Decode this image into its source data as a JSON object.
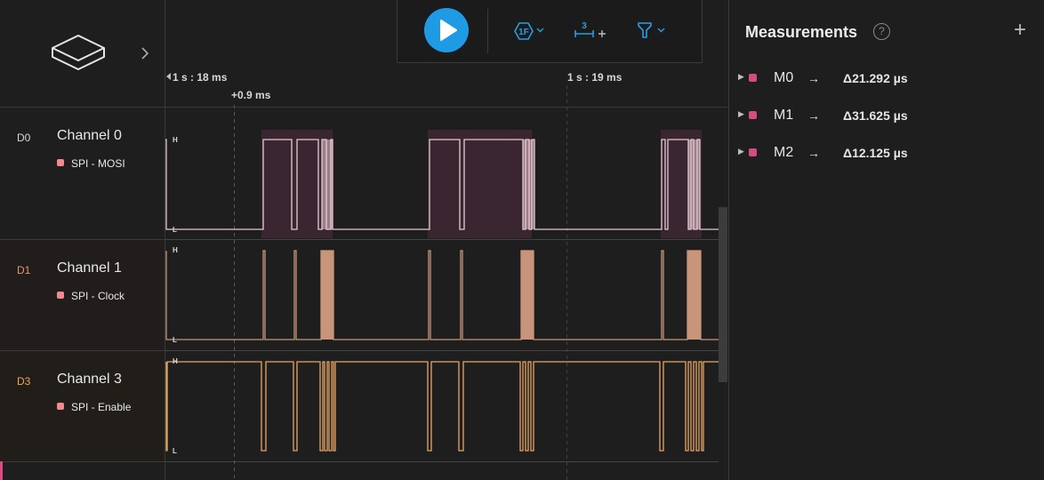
{
  "timeline": {
    "start_label": "1 s : 18 ms",
    "cursor_label": "+0.9 ms",
    "end_label": "1 s : 19 ms"
  },
  "toolbar": {
    "trigger_label": "1F",
    "marker_label": "3"
  },
  "channels": [
    {
      "id": "D0",
      "name": "Channel 0",
      "analyzer": "SPI - MOSI",
      "color": "#e7c9d2",
      "id_color": "#d8d8d8"
    },
    {
      "id": "D1",
      "name": "Channel 1",
      "analyzer": "SPI - Clock",
      "color": "#c8957a",
      "id_color": "#e8946e"
    },
    {
      "id": "D3",
      "name": "Channel 3",
      "analyzer": "SPI - Enable",
      "color": "#e8a565",
      "id_color": "#f0a550"
    }
  ],
  "level_labels": {
    "high": "H",
    "low": "L"
  },
  "measurements": {
    "title": "Measurements",
    "help": "?",
    "add": "+",
    "items": [
      {
        "name": "M0",
        "arrow": "→",
        "value": "Δ21.292 µs"
      },
      {
        "name": "M1",
        "arrow": "→",
        "value": "Δ31.625 µs"
      },
      {
        "name": "M2",
        "arrow": "→",
        "value": "Δ12.125 µs"
      }
    ]
  },
  "colors": {
    "accent": "#1f9be6",
    "measure_dot": "#d84a82",
    "mosi": "#e7c9d2",
    "clock": "#c8957a",
    "enable": "#e8a565"
  }
}
